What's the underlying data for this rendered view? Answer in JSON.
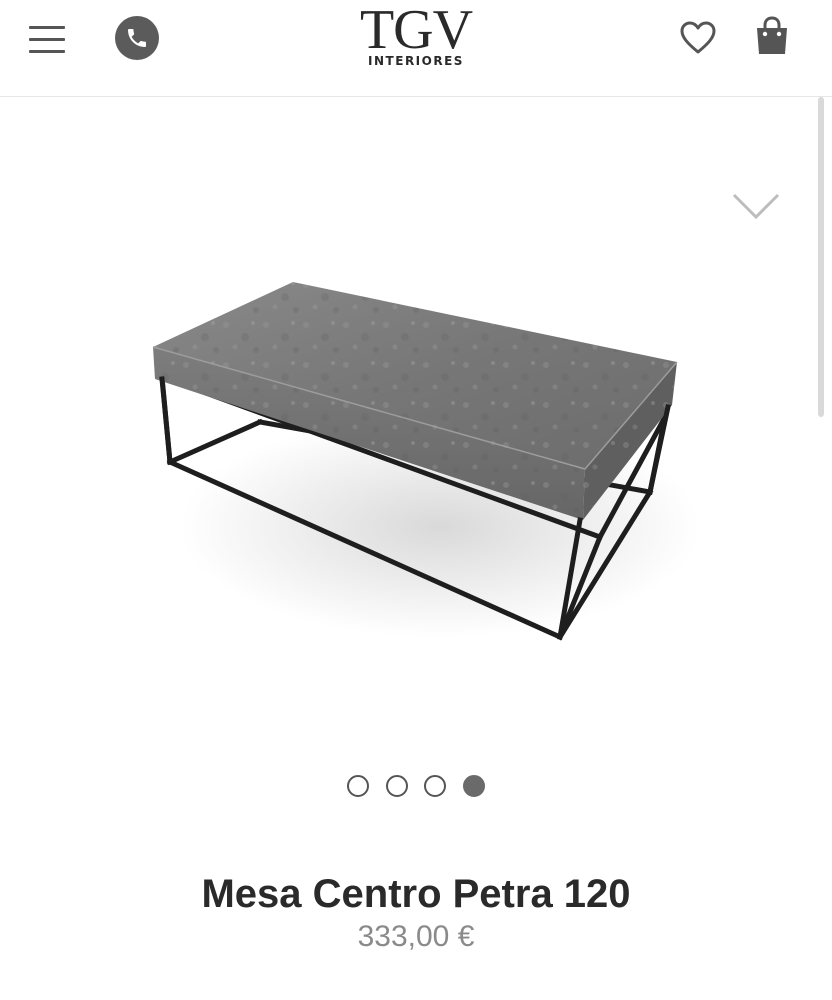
{
  "header": {
    "logo_mark": "TGV",
    "logo_sub": "INTERIORES",
    "icons": [
      "menu-icon",
      "phone-icon",
      "heart-icon",
      "shopping-bag-icon"
    ]
  },
  "gallery": {
    "image_alt": "Mesa Centro Petra 120",
    "dots_count": 4,
    "active_dot": 4
  },
  "product": {
    "title": "Mesa Centro Petra 120",
    "price": "333,00 €"
  },
  "colors": {
    "icon_gray": "#555555",
    "title_text": "#2a2a2a",
    "price_text": "#8a8a8a",
    "concrete_top": "#7c7c7c",
    "frame": "#1e1e1e"
  }
}
